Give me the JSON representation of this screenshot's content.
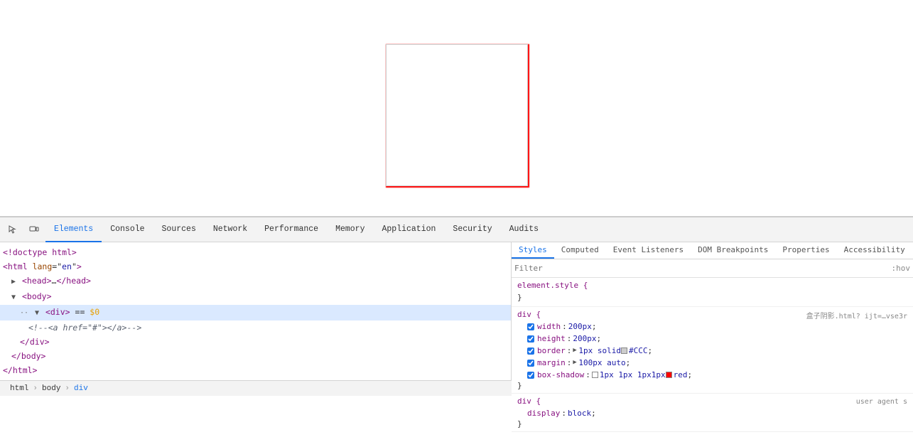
{
  "browser": {
    "preview_area_height": 305
  },
  "devtools": {
    "tabs": [
      {
        "label": "Elements",
        "active": true
      },
      {
        "label": "Console",
        "active": false
      },
      {
        "label": "Sources",
        "active": false
      },
      {
        "label": "Network",
        "active": false
      },
      {
        "label": "Performance",
        "active": false
      },
      {
        "label": "Memory",
        "active": false
      },
      {
        "label": "Application",
        "active": false
      },
      {
        "label": "Security",
        "active": false
      },
      {
        "label": "Audits",
        "active": false
      }
    ],
    "elements_panel": {
      "lines": [
        {
          "id": "line1",
          "indent": 0,
          "content": "<!doctype html>",
          "type": "doctype"
        },
        {
          "id": "line2",
          "indent": 0,
          "content": "<html lang=\"en\">",
          "type": "open"
        },
        {
          "id": "line3",
          "indent": 1,
          "content": "▶ <head>…</head>",
          "type": "collapsed"
        },
        {
          "id": "line4",
          "indent": 1,
          "content": "▼ <body>",
          "type": "open-arrow",
          "selected": false
        },
        {
          "id": "line5",
          "indent": 2,
          "content": "▼ <div> == $0",
          "type": "selected"
        },
        {
          "id": "line6",
          "indent": 3,
          "content": "<!--<a href=\"#\"></a>-->",
          "type": "comment"
        },
        {
          "id": "line7",
          "indent": 2,
          "content": "</div>",
          "type": "close"
        },
        {
          "id": "line8",
          "indent": 1,
          "content": "</body>",
          "type": "close"
        },
        {
          "id": "line9",
          "indent": 0,
          "content": "</html>",
          "type": "close"
        }
      ]
    },
    "breadcrumb": {
      "items": [
        {
          "label": "html",
          "active": false
        },
        {
          "label": "body",
          "active": false
        },
        {
          "label": "div",
          "active": true
        }
      ]
    },
    "styles_panel": {
      "subtabs": [
        {
          "label": "Styles",
          "active": true
        },
        {
          "label": "Computed",
          "active": false
        },
        {
          "label": "Event Listeners",
          "active": false
        },
        {
          "label": "DOM Breakpoints",
          "active": false
        },
        {
          "label": "Properties",
          "active": false
        },
        {
          "label": "Accessibility",
          "active": false
        }
      ],
      "filter_placeholder": "Filter",
      "filter_hov_label": ":hov",
      "rules": [
        {
          "id": "rule_element",
          "selector": "element.style {",
          "source": "",
          "properties": [],
          "close": "}"
        },
        {
          "id": "rule_div",
          "selector": "div {",
          "source": "盒子阴影.html? ijt=…vse3r",
          "properties": [
            {
              "name": "width",
              "value": "200px",
              "enabled": true,
              "color": null
            },
            {
              "name": "height",
              "value": "200px",
              "enabled": true,
              "color": null
            },
            {
              "name": "border",
              "value": "▶ 1px solid",
              "enabled": true,
              "color": "#CCC",
              "has_color": true,
              "color_hex": "#cccccc"
            },
            {
              "name": "margin",
              "value": "▶ 100px auto",
              "enabled": true,
              "color": null
            },
            {
              "name": "box-shadow",
              "value": "□1px 1px 1px 1px",
              "enabled": true,
              "color": "red",
              "has_color": true,
              "color_hex": "#ff0000",
              "is_box_shadow": true
            }
          ],
          "close": "}"
        },
        {
          "id": "rule_div_agent",
          "selector": "div {",
          "source": "user agent s",
          "properties": [
            {
              "name": "display",
              "value": "block",
              "enabled": true,
              "color": null
            }
          ],
          "close": "}"
        }
      ]
    }
  }
}
